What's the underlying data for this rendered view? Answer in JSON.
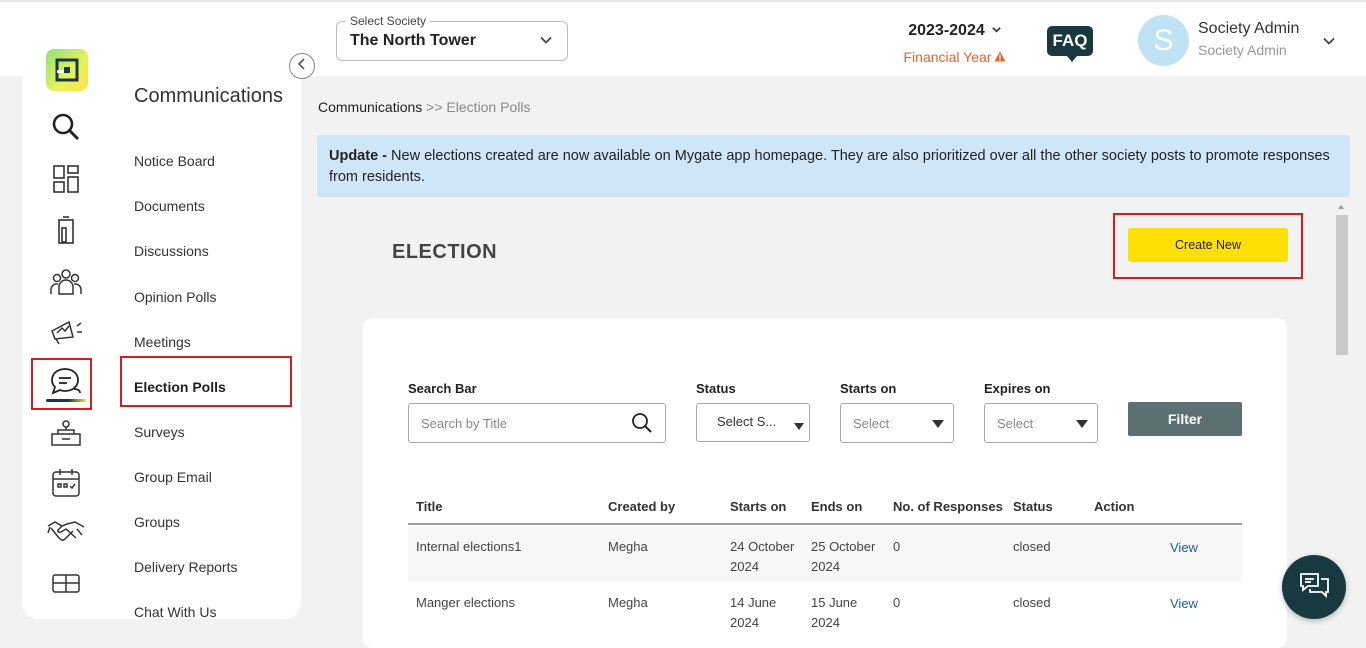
{
  "header": {
    "society_label": "Select Society",
    "society_value": "The North Tower",
    "financial_year": "2023-2024",
    "financial_year_label": "Financial Year",
    "faq_label": "FAQ",
    "avatar_letter": "S",
    "user_name": "Society Admin",
    "user_role": "Society Admin"
  },
  "sidebar": {
    "rail_icons": [
      "search-icon",
      "dashboard-icon",
      "building-icon",
      "residents-icon",
      "announcement-icon",
      "communications-icon",
      "helpdesk-icon",
      "calendar-icon",
      "handshake-icon",
      "assets-icon"
    ],
    "section_title": "Communications",
    "items": [
      {
        "label": "Notice Board"
      },
      {
        "label": "Documents"
      },
      {
        "label": "Discussions"
      },
      {
        "label": "Opinion Polls"
      },
      {
        "label": "Meetings"
      },
      {
        "label": "Election Polls"
      },
      {
        "label": "Surveys"
      },
      {
        "label": "Group Email"
      },
      {
        "label": "Groups"
      },
      {
        "label": "Delivery Reports"
      },
      {
        "label": "Chat With Us"
      }
    ]
  },
  "breadcrumb": {
    "parent": "Communications",
    "separator": ">>",
    "current": "Election Polls"
  },
  "banner": {
    "bold": "Update -",
    "text": "New elections created are now available on Mygate app homepage. They are also prioritized over all the other society posts to promote responses from residents."
  },
  "page": {
    "heading": "ELECTION",
    "create_button": "Create New"
  },
  "filters": {
    "search_label": "Search Bar",
    "search_placeholder": "Search by Title",
    "status_label": "Status",
    "status_value": "Select S...",
    "starts_label": "Starts on",
    "starts_value": "Select",
    "expires_label": "Expires on",
    "expires_value": "Select",
    "filter_button": "Filter"
  },
  "table": {
    "columns": [
      "Title",
      "Created by",
      "Starts on",
      "Ends on",
      "No. of Responses",
      "Status",
      "Action"
    ],
    "rows": [
      {
        "title": "Internal elections1",
        "created_by": "Megha",
        "starts_line1": "24 October",
        "starts_line2": "2024",
        "ends_line1": "25 October",
        "ends_line2": "2024",
        "responses": "0",
        "status": "closed",
        "action": "View"
      },
      {
        "title": "Manger elections",
        "created_by": "Megha",
        "starts_line1": "14 June",
        "starts_line2": "2024",
        "ends_line1": "15 June",
        "ends_line2": "2024",
        "responses": "0",
        "status": "closed",
        "action": "View"
      }
    ]
  },
  "colors": {
    "accent_yellow": "#fde106",
    "dark_teal": "#17393f",
    "highlight_red": "#d11f1f",
    "banner_blue": "#cfe6f8",
    "financial_year_orange": "#e8622c",
    "link_blue": "#1f5d97"
  }
}
